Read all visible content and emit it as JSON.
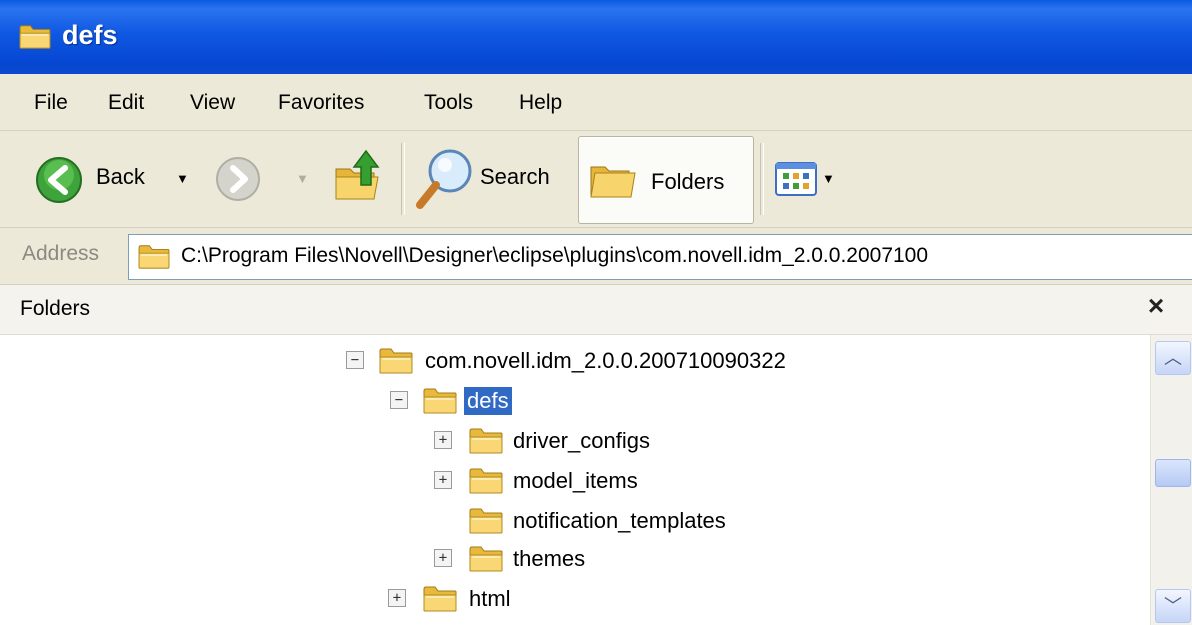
{
  "window": {
    "title": "defs"
  },
  "menu": {
    "items": [
      "File",
      "Edit",
      "View",
      "Favorites",
      "Tools",
      "Help"
    ]
  },
  "toolbar": {
    "back_label": "Back",
    "search_label": "Search",
    "folders_label": "Folders"
  },
  "address": {
    "label": "Address",
    "value": "C:\\Program Files\\Novell\\Designer\\eclipse\\plugins\\com.novell.idm_2.0.0.2007100"
  },
  "folders_pane": {
    "title": "Folders",
    "close_glyph": "×"
  },
  "tree": {
    "root": {
      "label": "com.novell.idm_2.0.0.200710090322",
      "expander": "−"
    },
    "defs": {
      "label": "defs",
      "expander": "−"
    },
    "children": [
      {
        "label": "driver_configs",
        "expander": "+"
      },
      {
        "label": "model_items",
        "expander": "+"
      },
      {
        "label": "notification_templates",
        "expander": ""
      },
      {
        "label": "themes",
        "expander": "+"
      }
    ],
    "html": {
      "label": "html",
      "expander": "+"
    }
  },
  "colors": {
    "titlebar": "#0a5be0",
    "selection": "#316ac5",
    "toolbar_bg": "#ece9d8"
  }
}
